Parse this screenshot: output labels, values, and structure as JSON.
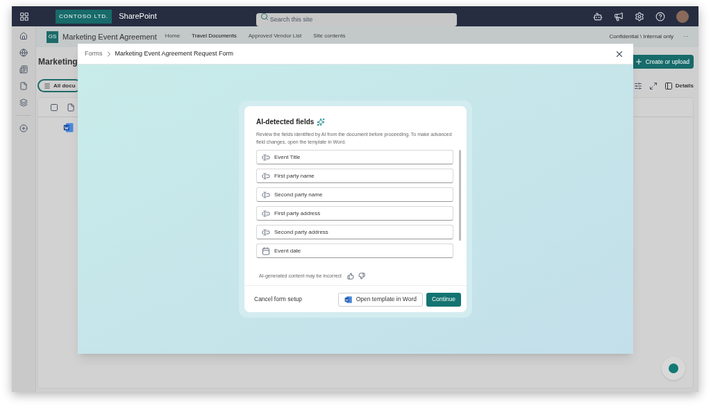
{
  "top_bar": {
    "org_name": "CONTOSO LTD.",
    "app_name": "SharePoint",
    "search": {
      "placeholder": "Search this site"
    }
  },
  "site_header": {
    "badge": "GS",
    "site_title": "Marketing Event Agreement",
    "nav": [
      {
        "label": "Home",
        "selected": false
      },
      {
        "label": "Travel Documents",
        "selected": true
      },
      {
        "label": "Approved Vendor List",
        "selected": false
      },
      {
        "label": "Site contents",
        "selected": false
      }
    ],
    "sensitivity": "Confidential \\ Internal only",
    "more": "···"
  },
  "library": {
    "title": "Marketing",
    "view_button": "All docu",
    "create_button": "Create or upload",
    "details_button": "Details"
  },
  "dialog": {
    "breadcrumb": [
      "Forms",
      "Marketing Event Agreement Request Form"
    ],
    "card": {
      "title": "AI-detected fields",
      "description": "Review the fields identified by AI from the document before proceeding. To make advanced field changes, open the template in Word.",
      "fields": [
        {
          "label": "Event Title",
          "kind": "text"
        },
        {
          "label": "First party name",
          "kind": "text"
        },
        {
          "label": "Second party name",
          "kind": "text"
        },
        {
          "label": "First party address",
          "kind": "text"
        },
        {
          "label": "Second party address",
          "kind": "text"
        },
        {
          "label": "Event date",
          "kind": "date"
        }
      ],
      "disclaimer": "AI-generated content may be incorrect",
      "cancel": "Cancel form setup",
      "open_word": "Open template in Word",
      "continue": "Continue"
    }
  }
}
